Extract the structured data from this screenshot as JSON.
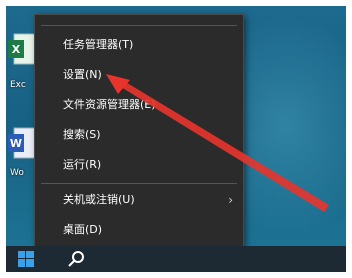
{
  "desktop": {
    "icons": [
      {
        "label": "Exc"
      },
      {
        "label": "Wo"
      }
    ]
  },
  "context_menu": {
    "items": [
      {
        "label": "任务管理器(T)"
      },
      {
        "label": "设置(N)"
      },
      {
        "label": "文件资源管理器(E)"
      },
      {
        "label": "搜索(S)"
      },
      {
        "label": "运行(R)"
      },
      {
        "label": "关机或注销(U)",
        "submenu_indicator": "›"
      },
      {
        "label": "桌面(D)"
      }
    ]
  },
  "colors": {
    "menu_background": "#2b2b2b",
    "menu_text": "#ffffff",
    "annotation_arrow": "#e8342c",
    "desktop_background": "#176184"
  }
}
